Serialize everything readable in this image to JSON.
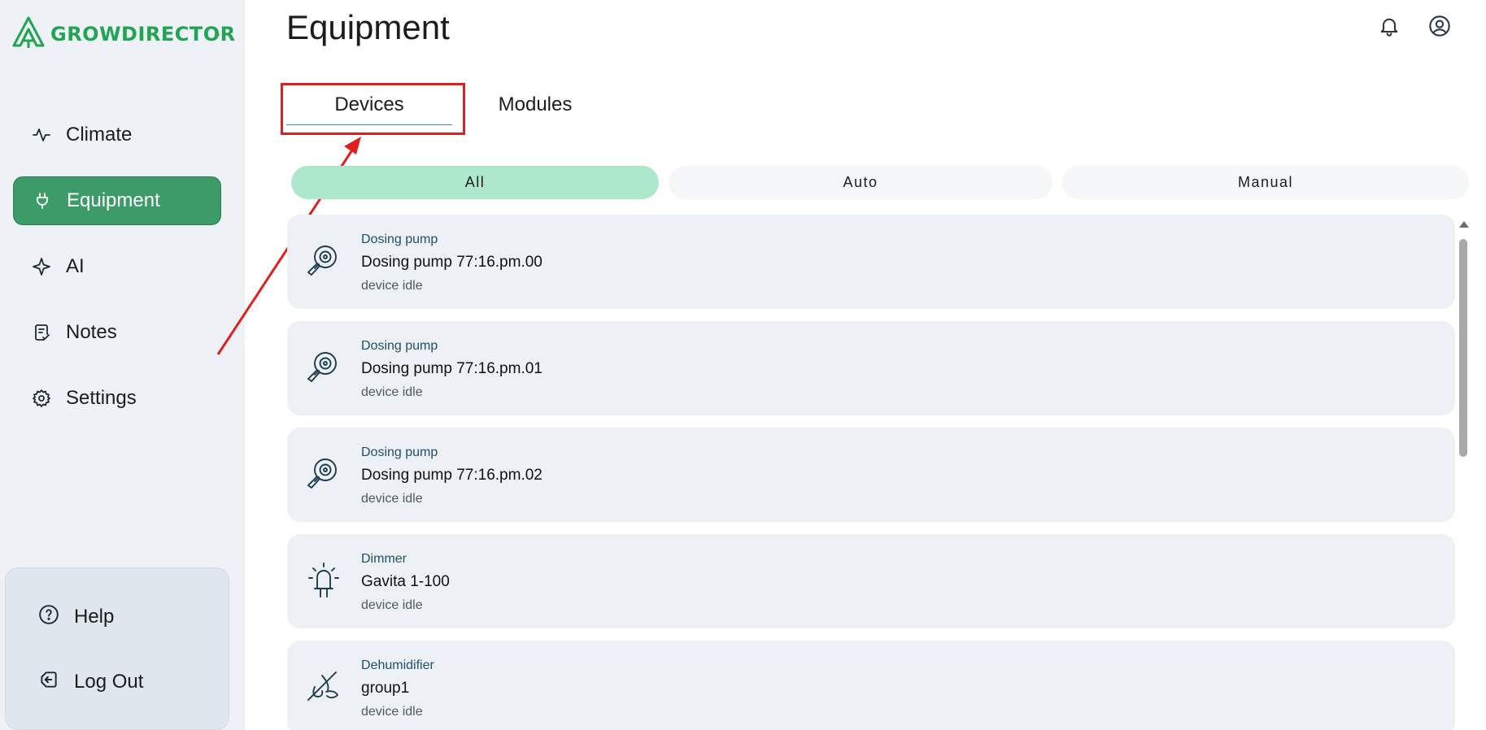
{
  "brand": {
    "name": "GROWDIRECTOR",
    "accent": "#22a553"
  },
  "sidebar": {
    "items": [
      {
        "label": "Climate",
        "icon": "activity-icon",
        "active": false
      },
      {
        "label": "Equipment",
        "icon": "plug-icon",
        "active": true
      },
      {
        "label": "AI",
        "icon": "sparkle-icon",
        "active": false
      },
      {
        "label": "Notes",
        "icon": "notes-icon",
        "active": false
      },
      {
        "label": "Settings",
        "icon": "gear-icon",
        "active": false
      }
    ],
    "bottom": [
      {
        "label": "Help",
        "icon": "help-icon"
      },
      {
        "label": "Log Out",
        "icon": "logout-icon"
      }
    ]
  },
  "header": {
    "title": "Equipment",
    "icons": [
      "bell-icon",
      "user-icon"
    ]
  },
  "tabs": [
    {
      "label": "Devices",
      "active": true
    },
    {
      "label": "Modules",
      "active": false
    }
  ],
  "filters": [
    {
      "label": "All",
      "active": true
    },
    {
      "label": "Auto",
      "active": false
    },
    {
      "label": "Manual",
      "active": false
    }
  ],
  "devices": [
    {
      "type": "Dosing pump",
      "name": "Dosing pump 77:16.pm.00",
      "status": "device idle",
      "icon": "dosing-pump-icon"
    },
    {
      "type": "Dosing pump",
      "name": "Dosing pump 77:16.pm.01",
      "status": "device idle",
      "icon": "dosing-pump-icon"
    },
    {
      "type": "Dosing pump",
      "name": "Dosing pump 77:16.pm.02",
      "status": "device idle",
      "icon": "dosing-pump-icon"
    },
    {
      "type": "Dimmer",
      "name": "Gavita 1-100",
      "status": "device idle",
      "icon": "lamp-icon"
    },
    {
      "type": "Dehumidifier",
      "name": "group1",
      "status": "device idle",
      "icon": "dehumidifier-icon"
    }
  ],
  "colors": {
    "active_nav": "#3d9b6a",
    "active_filter": "#aee8cc",
    "annotation": "#e02020"
  }
}
